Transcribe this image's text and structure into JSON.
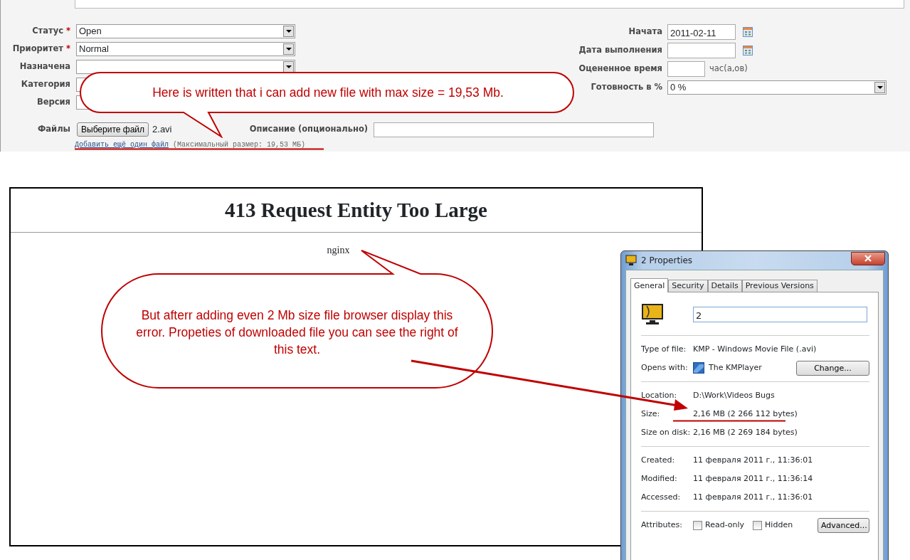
{
  "form": {
    "left_fields": [
      {
        "label": "Статус",
        "required_mark": "*",
        "kind": "select",
        "value": "Open"
      },
      {
        "label": "Приоритет",
        "required_mark": "*",
        "kind": "select",
        "value": "Normal"
      },
      {
        "label": "Назначена",
        "kind": "select"
      },
      {
        "label": "Категория",
        "kind": "field"
      },
      {
        "label": "Версия",
        "kind": "field"
      }
    ],
    "right_fields": [
      {
        "label": "Начата",
        "kind": "date",
        "value": "2011-02-11"
      },
      {
        "label": "Дата выполнения",
        "kind": "date"
      },
      {
        "label": "Оцененное время",
        "kind": "hours",
        "unit": "час(а,ов)"
      },
      {
        "label": "Готовность в %",
        "kind": "select",
        "value": "0 %"
      }
    ],
    "files": {
      "label": "Файлы",
      "button": "Выберите файл",
      "file_name": "2.avi"
    },
    "description": {
      "label": "Описание (опционально)"
    },
    "add_file_link": "Добавить ещё один файл",
    "max_size_note": "(Максимальный размер: 19,53 МБ)"
  },
  "error_page": {
    "title": "413 Request Entity Too Large",
    "server": "nginx"
  },
  "properties_window": {
    "title": "2 Properties",
    "tabs": [
      {
        "label": "General",
        "selected": true
      },
      {
        "label": "Security",
        "selected": false
      },
      {
        "label": "Details",
        "selected": false
      },
      {
        "label": "Previous Versions",
        "selected": false
      }
    ],
    "name": "2",
    "groups": [
      [
        {
          "label": "Type of file:",
          "value": "KMP - Windows Movie File (.avi)"
        },
        {
          "label": "Opens with:",
          "value": "The KMPlayer",
          "button": "Change..."
        }
      ],
      [
        {
          "label": "Location:",
          "value": "D:\\Work\\Videos Bugs"
        },
        {
          "label": "Size:",
          "value": "2,16 MB (2 266 112 bytes)",
          "underlined": true
        },
        {
          "label": "Size on disk:",
          "value": "2,16 MB (2 269 184 bytes)"
        }
      ],
      [
        {
          "label": "Created:",
          "value": "11 февраля 2011 г., 11:36:01"
        },
        {
          "label": "Modified:",
          "value": "11 февраля 2011 г., 11:36:14"
        },
        {
          "label": "Accessed:",
          "value": "11 февраля 2011 г., 11:36:01"
        }
      ]
    ],
    "attributes": {
      "label": "Attributes:",
      "checkboxes": [
        {
          "label": "Read-only",
          "checked": false
        },
        {
          "label": "Hidden",
          "checked": false
        }
      ],
      "button": "Advanced..."
    }
  },
  "callouts": [
    {
      "text": "Here is written that i can add new file with max size = 19,53 Mb."
    },
    {
      "text": "But afterr adding even 2 Mb size file browser display this error. Propeties of downloaded file you can see the right of this text."
    }
  ]
}
